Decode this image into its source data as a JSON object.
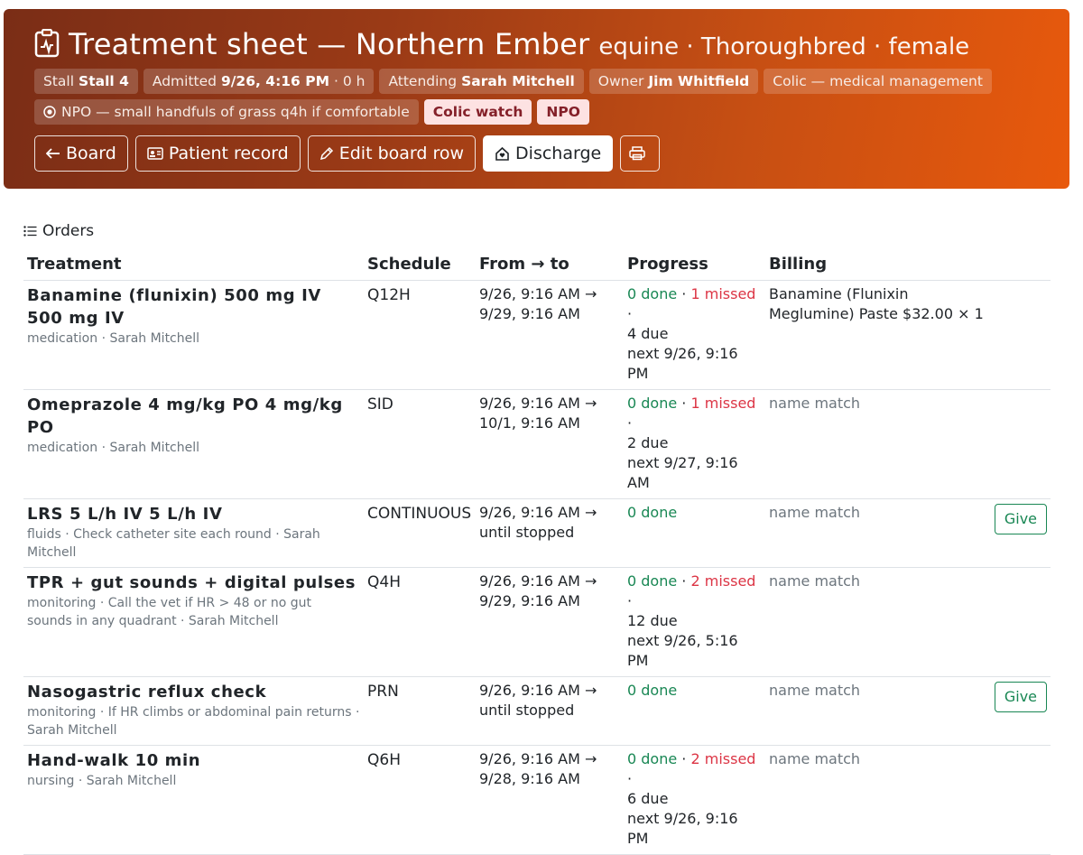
{
  "header": {
    "title": "Treatment sheet — Northern Ember",
    "subtitle": "equine · Thoroughbred · female",
    "chips": {
      "stall_label": "Stall",
      "stall_value": "Stall 4",
      "admitted_label": "Admitted",
      "admitted_value": "9/26, 4:16 PM",
      "admitted_suffix": "· 0 h",
      "attending_label": "Attending",
      "attending_value": "Sarah Mitchell",
      "owner_label": "Owner",
      "owner_value": "Jim Whitfield",
      "problem": "Colic — medical management",
      "diet": "NPO — small handfuls of grass q4h if comfortable",
      "flag_colic": "Colic watch",
      "flag_npo": "NPO"
    },
    "buttons": {
      "board": "Board",
      "patient_record": "Patient record",
      "edit_board_row": "Edit board row",
      "discharge": "Discharge"
    }
  },
  "orders": {
    "heading": "Orders",
    "columns": [
      "Treatment",
      "Schedule",
      "From → to",
      "Progress",
      "Billing"
    ],
    "rows": [
      {
        "name": "Banamine (flunixin) 500 mg IV 500 mg IV",
        "meta": "medication · Sarah Mitchell",
        "schedule": "Q12H",
        "from": "9/26, 9:16 AM →",
        "to": "9/29, 9:16 AM",
        "done": "0 done",
        "missed": "1 missed",
        "due": "4 due",
        "next": "next 9/26, 9:16 PM",
        "billing": "Banamine (Flunixin Meglumine) Paste $32.00 × 1",
        "give": ""
      },
      {
        "name": "Omeprazole 4 mg/kg PO 4 mg/kg PO",
        "meta": "medication · Sarah Mitchell",
        "schedule": "SID",
        "from": "9/26, 9:16 AM →",
        "to": "10/1, 9:16 AM",
        "done": "0 done",
        "missed": "1 missed",
        "due": "2 due",
        "next": "next 9/27, 9:16 AM",
        "billing": "name match",
        "give": ""
      },
      {
        "name": "LRS 5 L/h IV 5 L/h IV",
        "meta": "fluids · Check catheter site each round · Sarah Mitchell",
        "schedule": "CONTINUOUS",
        "from": "9/26, 9:16 AM →",
        "to": "until stopped",
        "done": "0 done",
        "missed": "",
        "due": "",
        "next": "",
        "billing": "name match",
        "give": "Give"
      },
      {
        "name": "TPR + gut sounds + digital pulses",
        "meta": "monitoring · Call the vet if HR > 48 or no gut sounds in any quadrant · Sarah Mitchell",
        "schedule": "Q4H",
        "from": "9/26, 9:16 AM →",
        "to": "9/29, 9:16 AM",
        "done": "0 done",
        "missed": "2 missed",
        "due": "12 due",
        "next": "next 9/26, 5:16 PM",
        "billing": "name match",
        "give": ""
      },
      {
        "name": "Nasogastric reflux check",
        "meta": "monitoring · If HR climbs or abdominal pain returns · Sarah Mitchell",
        "schedule": "PRN",
        "from": "9/26, 9:16 AM →",
        "to": "until stopped",
        "done": "0 done",
        "missed": "",
        "due": "",
        "next": "",
        "billing": "name match",
        "give": "Give"
      },
      {
        "name": "Hand-walk 10 min",
        "meta": "nursing · Sarah Mitchell",
        "schedule": "Q6H",
        "from": "9/26, 9:16 AM →",
        "to": "9/28, 9:16 AM",
        "done": "0 done",
        "missed": "2 missed",
        "due": "6 due",
        "next": "next 9/26, 9:16 PM",
        "billing": "name match",
        "give": ""
      }
    ]
  },
  "colors": {
    "header_start": "#7a2d16",
    "header_end": "#e8590c",
    "done": "#198754",
    "missed": "#dc3545"
  }
}
